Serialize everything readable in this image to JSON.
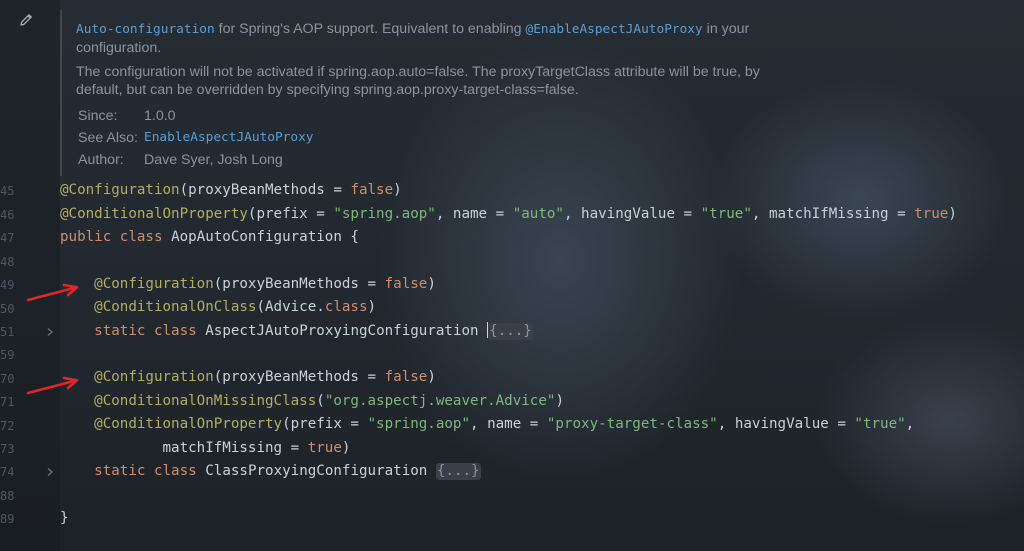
{
  "doc": {
    "p1_code": "Auto-configuration",
    "p1_text1": " for Spring's AOP support. Equivalent to enabling ",
    "p1_code2": "@EnableAspectJAutoProxy",
    "p1_text2": " in your configuration.",
    "p2": "The configuration will not be activated if spring.aop.auto=false. The proxyTargetClass attribute will be true, by default, but can be overridden by specifying spring.aop.proxy-target-class=false.",
    "since_label": "Since:",
    "since_value": "1.0.0",
    "see_also_label": "See Also:",
    "see_also_value": "EnableAspectJAutoProxy",
    "author_label": "Author:",
    "author_value": "Dave Syer, Josh Long"
  },
  "line_numbers": [
    "45",
    "46",
    "47",
    "48",
    "49",
    "50",
    "51",
    "59",
    "70",
    "71",
    "72",
    "73",
    "74",
    "88",
    "89"
  ],
  "code": {
    "l45": {
      "ann": "@Configuration",
      "p1": "(proxyBeanMethods = ",
      "kw": "false",
      "p2": ")"
    },
    "l46": {
      "ann": "@ConditionalOnProperty",
      "p1": "(prefix = ",
      "s1": "\"spring.aop\"",
      "p2": ", name = ",
      "s2": "\"auto\"",
      "p3": ", havingValue = ",
      "s3": "\"true\"",
      "p4": ", matchIfMissing = ",
      "kw": "true",
      "p5": ")"
    },
    "l47": {
      "kw1": "public",
      "kw2": "class",
      "name": "AopAutoConfiguration {"
    },
    "l49": {
      "ann": "@Configuration",
      "p1": "(proxyBeanMethods = ",
      "kw": "false",
      "p2": ")"
    },
    "l50": {
      "ann": "@ConditionalOnClass",
      "p1": "(Advice.",
      "kw": "class",
      "p2": ")"
    },
    "l51": {
      "kw1": "static",
      "kw2": "class",
      "name": "AspectJAutoProxyingConfiguration ",
      "fold": "{...}"
    },
    "l70": {
      "ann": "@Configuration",
      "p1": "(proxyBeanMethods = ",
      "kw": "false",
      "p2": ")"
    },
    "l71": {
      "ann": "@ConditionalOnMissingClass",
      "p1": "(",
      "s1": "\"org.aspectj.weaver.Advice\"",
      "p2": ")"
    },
    "l72": {
      "ann": "@ConditionalOnProperty",
      "p1": "(prefix = ",
      "s1": "\"spring.aop\"",
      "p2": ", name = ",
      "s2": "\"proxy-target-class\"",
      "p3": ", havingValue = ",
      "s3": "\"true\"",
      "p4": ","
    },
    "l73": {
      "p1": "matchIfMissing = ",
      "kw": "true",
      "p2": ")"
    },
    "l74": {
      "kw1": "static",
      "kw2": "class",
      "name": "ClassProxyingConfiguration ",
      "fold": "{...}"
    },
    "l89": {
      "text": "}"
    }
  },
  "colors": {
    "annotation": "#b3ae60",
    "keyword": "#cf8e6d",
    "string": "#7fb87a",
    "link": "#5b9ed6",
    "arrow": "#e0262b"
  },
  "icons": [
    "pencil-icon",
    "chevron-right-icon",
    "red-arrow-icon"
  ]
}
